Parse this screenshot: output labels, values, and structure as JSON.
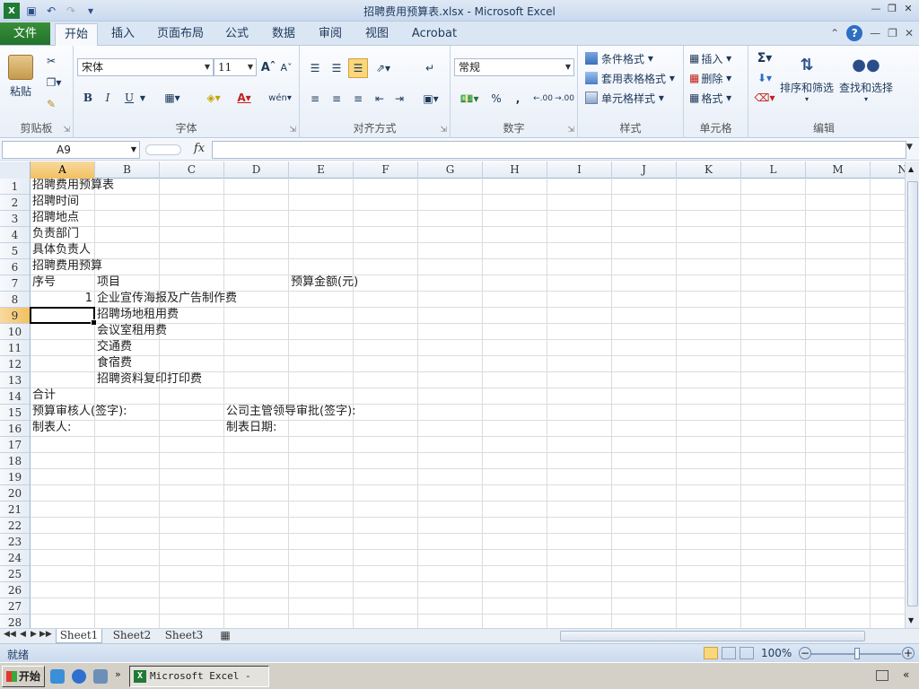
{
  "window": {
    "title": "招聘费用预算表.xlsx  -  Microsoft Excel"
  },
  "tabs": {
    "file": "文件",
    "items": [
      "开始",
      "插入",
      "页面布局",
      "公式",
      "数据",
      "审阅",
      "视图",
      "Acrobat"
    ],
    "active": "开始"
  },
  "ribbon": {
    "clipboard": {
      "label": "剪贴板",
      "paste": "粘贴"
    },
    "font": {
      "label": "字体",
      "name": "宋体",
      "size": "11",
      "bold": "B",
      "italic": "I",
      "underline": "U",
      "phonetic": "wén"
    },
    "alignment": {
      "label": "对齐方式"
    },
    "number": {
      "label": "数字",
      "format": "常规",
      "percent": "%",
      "comma": ",",
      "inc_decimal": ".00",
      "dec_decimal": ".00"
    },
    "styles": {
      "label": "样式",
      "conditional": "条件格式",
      "table": "套用表格格式",
      "cell_styles": "单元格样式"
    },
    "cells": {
      "label": "单元格",
      "insert": "插入",
      "delete": "删除",
      "format": "格式"
    },
    "editing": {
      "label": "编辑",
      "sort": "排序和筛选",
      "find": "查找和选择"
    }
  },
  "formula_bar": {
    "name_box": "A9",
    "fx": "fx",
    "value": ""
  },
  "grid": {
    "columns": [
      "A",
      "B",
      "C",
      "D",
      "E",
      "F",
      "G",
      "H",
      "I",
      "J",
      "K",
      "L",
      "M",
      "N"
    ],
    "rows": [
      "1",
      "2",
      "3",
      "4",
      "5",
      "6",
      "7",
      "8",
      "9",
      "10",
      "11",
      "12",
      "13",
      "14",
      "15",
      "16",
      "17",
      "18",
      "19",
      "20",
      "21",
      "22",
      "23",
      "24",
      "25",
      "26",
      "27",
      "28"
    ],
    "selected_column": "A",
    "selected_row": "9",
    "cells": {
      "A1": "招聘费用预算表",
      "A2": "招聘时间",
      "A3": "招聘地点",
      "A4": "负责部门",
      "A5": "具体负责人",
      "A6": "招聘费用预算",
      "A7": "序号",
      "B7": "项目",
      "E7": "预算金额(元)",
      "A8": "1",
      "B8": "企业宣传海报及广告制作费",
      "B9": "招聘场地租用费",
      "B10": "会议室租用费",
      "B11": "交通费",
      "B12": "食宿费",
      "B13": "招聘资料复印打印费",
      "A14": "合计",
      "A15": "预算审核人(签字):",
      "D15": "公司主管领导审批(签字):",
      "A16": "制表人:",
      "D16": "制表日期:"
    }
  },
  "sheets": {
    "items": [
      "Sheet1",
      "Sheet2",
      "Sheet3"
    ],
    "active": "Sheet1"
  },
  "status": {
    "ready": "就绪",
    "zoom": "100%"
  },
  "taskbar": {
    "start": "开始",
    "task": "Microsoft Excel - ..."
  },
  "colors": {
    "file_tab": "#21732a",
    "selection_header": "#f1c15f",
    "gridline": "#dadcdd"
  }
}
